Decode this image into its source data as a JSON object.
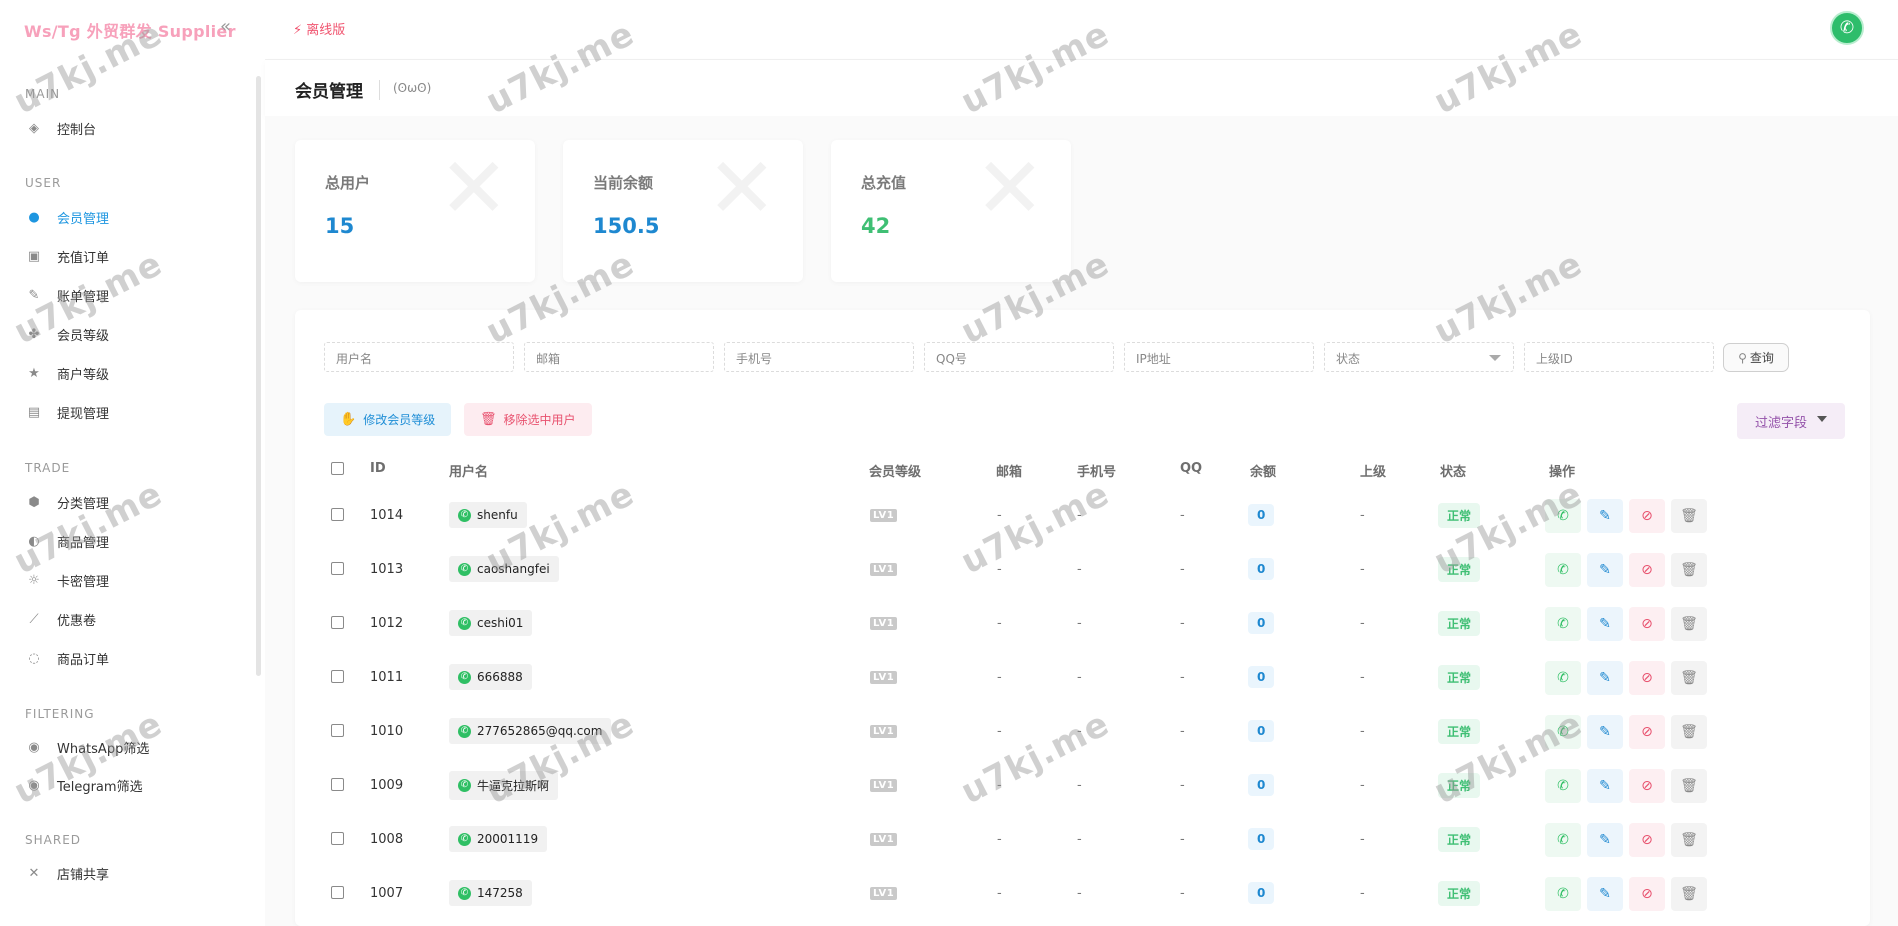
{
  "sidebar": {
    "brand": "Ws/Tg 外贸群发 Supplier",
    "sections": [
      {
        "label": "MAIN",
        "items": [
          {
            "label": "控制台",
            "icon": "dashboard-icon"
          }
        ]
      },
      {
        "label": "USER",
        "items": [
          {
            "label": "会员管理",
            "icon": "user-icon",
            "active": true
          },
          {
            "label": "充值订单",
            "icon": "recharge-icon"
          },
          {
            "label": "账单管理",
            "icon": "bill-icon"
          },
          {
            "label": "会员等级",
            "icon": "level-icon"
          },
          {
            "label": "商户等级",
            "icon": "merchant-icon"
          },
          {
            "label": "提现管理",
            "icon": "withdraw-icon"
          }
        ]
      },
      {
        "label": "TRADE",
        "items": [
          {
            "label": "分类管理",
            "icon": "category-icon"
          },
          {
            "label": "商品管理",
            "icon": "product-icon"
          },
          {
            "label": "卡密管理",
            "icon": "card-icon"
          },
          {
            "label": "优惠卷",
            "icon": "coupon-icon"
          },
          {
            "label": "商品订单",
            "icon": "order-icon"
          }
        ]
      },
      {
        "label": "FILTERING",
        "items": [
          {
            "label": "WhatsApp筛选",
            "icon": "whatsapp-filter-icon"
          },
          {
            "label": "Telegram筛选",
            "icon": "telegram-filter-icon"
          }
        ]
      },
      {
        "label": "SHARED",
        "items": [
          {
            "label": "店铺共享",
            "icon": "share-icon"
          }
        ]
      }
    ]
  },
  "topbar": {
    "offline_label": "离线版"
  },
  "page": {
    "title": "会员管理",
    "face": "(ʘωʘ)"
  },
  "stats": [
    {
      "label": "总用户",
      "value": "15",
      "color": "#1e88d0"
    },
    {
      "label": "当前余额",
      "value": "150.5",
      "color": "#1e88d0"
    },
    {
      "label": "总充值",
      "value": "42",
      "color": "#3fbf74"
    }
  ],
  "filters": {
    "username": "用户名",
    "email": "邮箱",
    "phone": "手机号",
    "qq": "QQ号",
    "ip": "IP地址",
    "status": "状态",
    "parent_id": "上级ID",
    "query_button": "查询"
  },
  "actions": {
    "modify_level": "修改会员等级",
    "remove_selected": "移除选中用户",
    "filter_fields": "过滤字段"
  },
  "table": {
    "headers": {
      "id": "ID",
      "username": "用户名",
      "level": "会员等级",
      "email": "邮箱",
      "phone": "手机号",
      "qq": "QQ",
      "balance": "余额",
      "parent": "上级",
      "status": "状态",
      "ops": "操作"
    },
    "rows": [
      {
        "id": "1014",
        "username": "shenfu",
        "level": "LV1",
        "email": "-",
        "phone": "-",
        "qq": "-",
        "balance": "0",
        "parent": "-",
        "status": "正常"
      },
      {
        "id": "1013",
        "username": "caoshangfei",
        "level": "LV1",
        "email": "-",
        "phone": "-",
        "qq": "-",
        "balance": "0",
        "parent": "-",
        "status": "正常"
      },
      {
        "id": "1012",
        "username": "ceshi01",
        "level": "LV1",
        "email": "-",
        "phone": "-",
        "qq": "-",
        "balance": "0",
        "parent": "-",
        "status": "正常"
      },
      {
        "id": "1011",
        "username": "666888",
        "level": "LV1",
        "email": "-",
        "phone": "-",
        "qq": "-",
        "balance": "0",
        "parent": "-",
        "status": "正常"
      },
      {
        "id": "1010",
        "username": "277652865@qq.com",
        "level": "LV1",
        "email": "-",
        "phone": "-",
        "qq": "-",
        "balance": "0",
        "parent": "-",
        "status": "正常"
      },
      {
        "id": "1009",
        "username": "牛逼克拉斯啊",
        "level": "LV1",
        "email": "-",
        "phone": "-",
        "qq": "-",
        "balance": "0",
        "parent": "-",
        "status": "正常"
      },
      {
        "id": "1008",
        "username": "20001119",
        "level": "LV1",
        "email": "-",
        "phone": "-",
        "qq": "-",
        "balance": "0",
        "parent": "-",
        "status": "正常"
      },
      {
        "id": "1007",
        "username": "147258",
        "level": "LV1",
        "email": "-",
        "phone": "-",
        "qq": "-",
        "balance": "0",
        "parent": "-",
        "status": "正常"
      }
    ]
  },
  "watermark": "u7kj.me"
}
